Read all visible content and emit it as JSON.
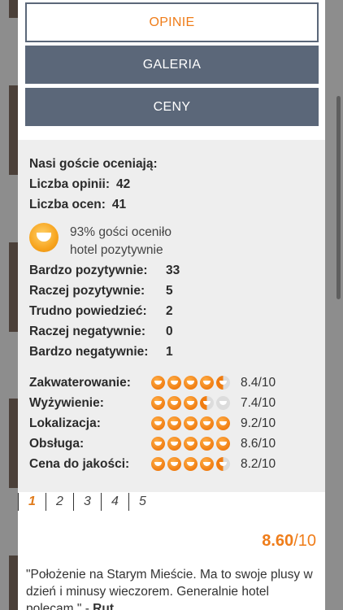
{
  "tabs": {
    "opinie": "OPINIE",
    "galeria": "GALERIA",
    "ceny": "CENY"
  },
  "summary": {
    "heading": "Nasi goście oceniają:",
    "opinions_label": "Liczba opinii:",
    "opinions_value": "42",
    "ratings_label": "Liczba ocen:",
    "ratings_value": "41",
    "positive_text_1": "93% gości oceniło",
    "positive_text_2": "hotel pozytywnie"
  },
  "breakdown": [
    {
      "label": "Bardzo pozytywnie:",
      "value": "33"
    },
    {
      "label": "Raczej pozytywnie:",
      "value": "5"
    },
    {
      "label": "Trudno powiedzieć:",
      "value": "2"
    },
    {
      "label": "Raczej negatywnie:",
      "value": "0"
    },
    {
      "label": "Bardzo negatywnie:",
      "value": "1"
    }
  ],
  "categories": [
    {
      "label": "Zakwaterowanie:",
      "score": "8.4/10",
      "icons": [
        1,
        1,
        1,
        1,
        0.5
      ]
    },
    {
      "label": "Wyżywienie:",
      "score": "7.4/10",
      "icons": [
        1,
        1,
        1,
        0.5,
        0
      ]
    },
    {
      "label": "Lokalizacja:",
      "score": "9.2/10",
      "icons": [
        1,
        1,
        1,
        1,
        1
      ]
    },
    {
      "label": "Obsługa:",
      "score": "8.6/10",
      "icons": [
        1,
        1,
        1,
        1,
        1
      ]
    },
    {
      "label": "Cena do jakości:",
      "score": "8.2/10",
      "icons": [
        1,
        1,
        1,
        1,
        0.5
      ]
    }
  ],
  "pager": {
    "pages": [
      "1",
      "2",
      "3",
      "4",
      "5"
    ],
    "active": "1"
  },
  "review": {
    "score": "8.60",
    "scale": "/10",
    "text": "\"Położenie na Starym Mieście. Ma to swoje plusy w dzień i minusy wieczorem. Generalnie hotel polecam.\" - ",
    "author": "Rut..."
  },
  "colors": {
    "accent": "#ef7d1a",
    "tab_bg": "#5b6779",
    "stats_bg": "#eeeeee"
  }
}
